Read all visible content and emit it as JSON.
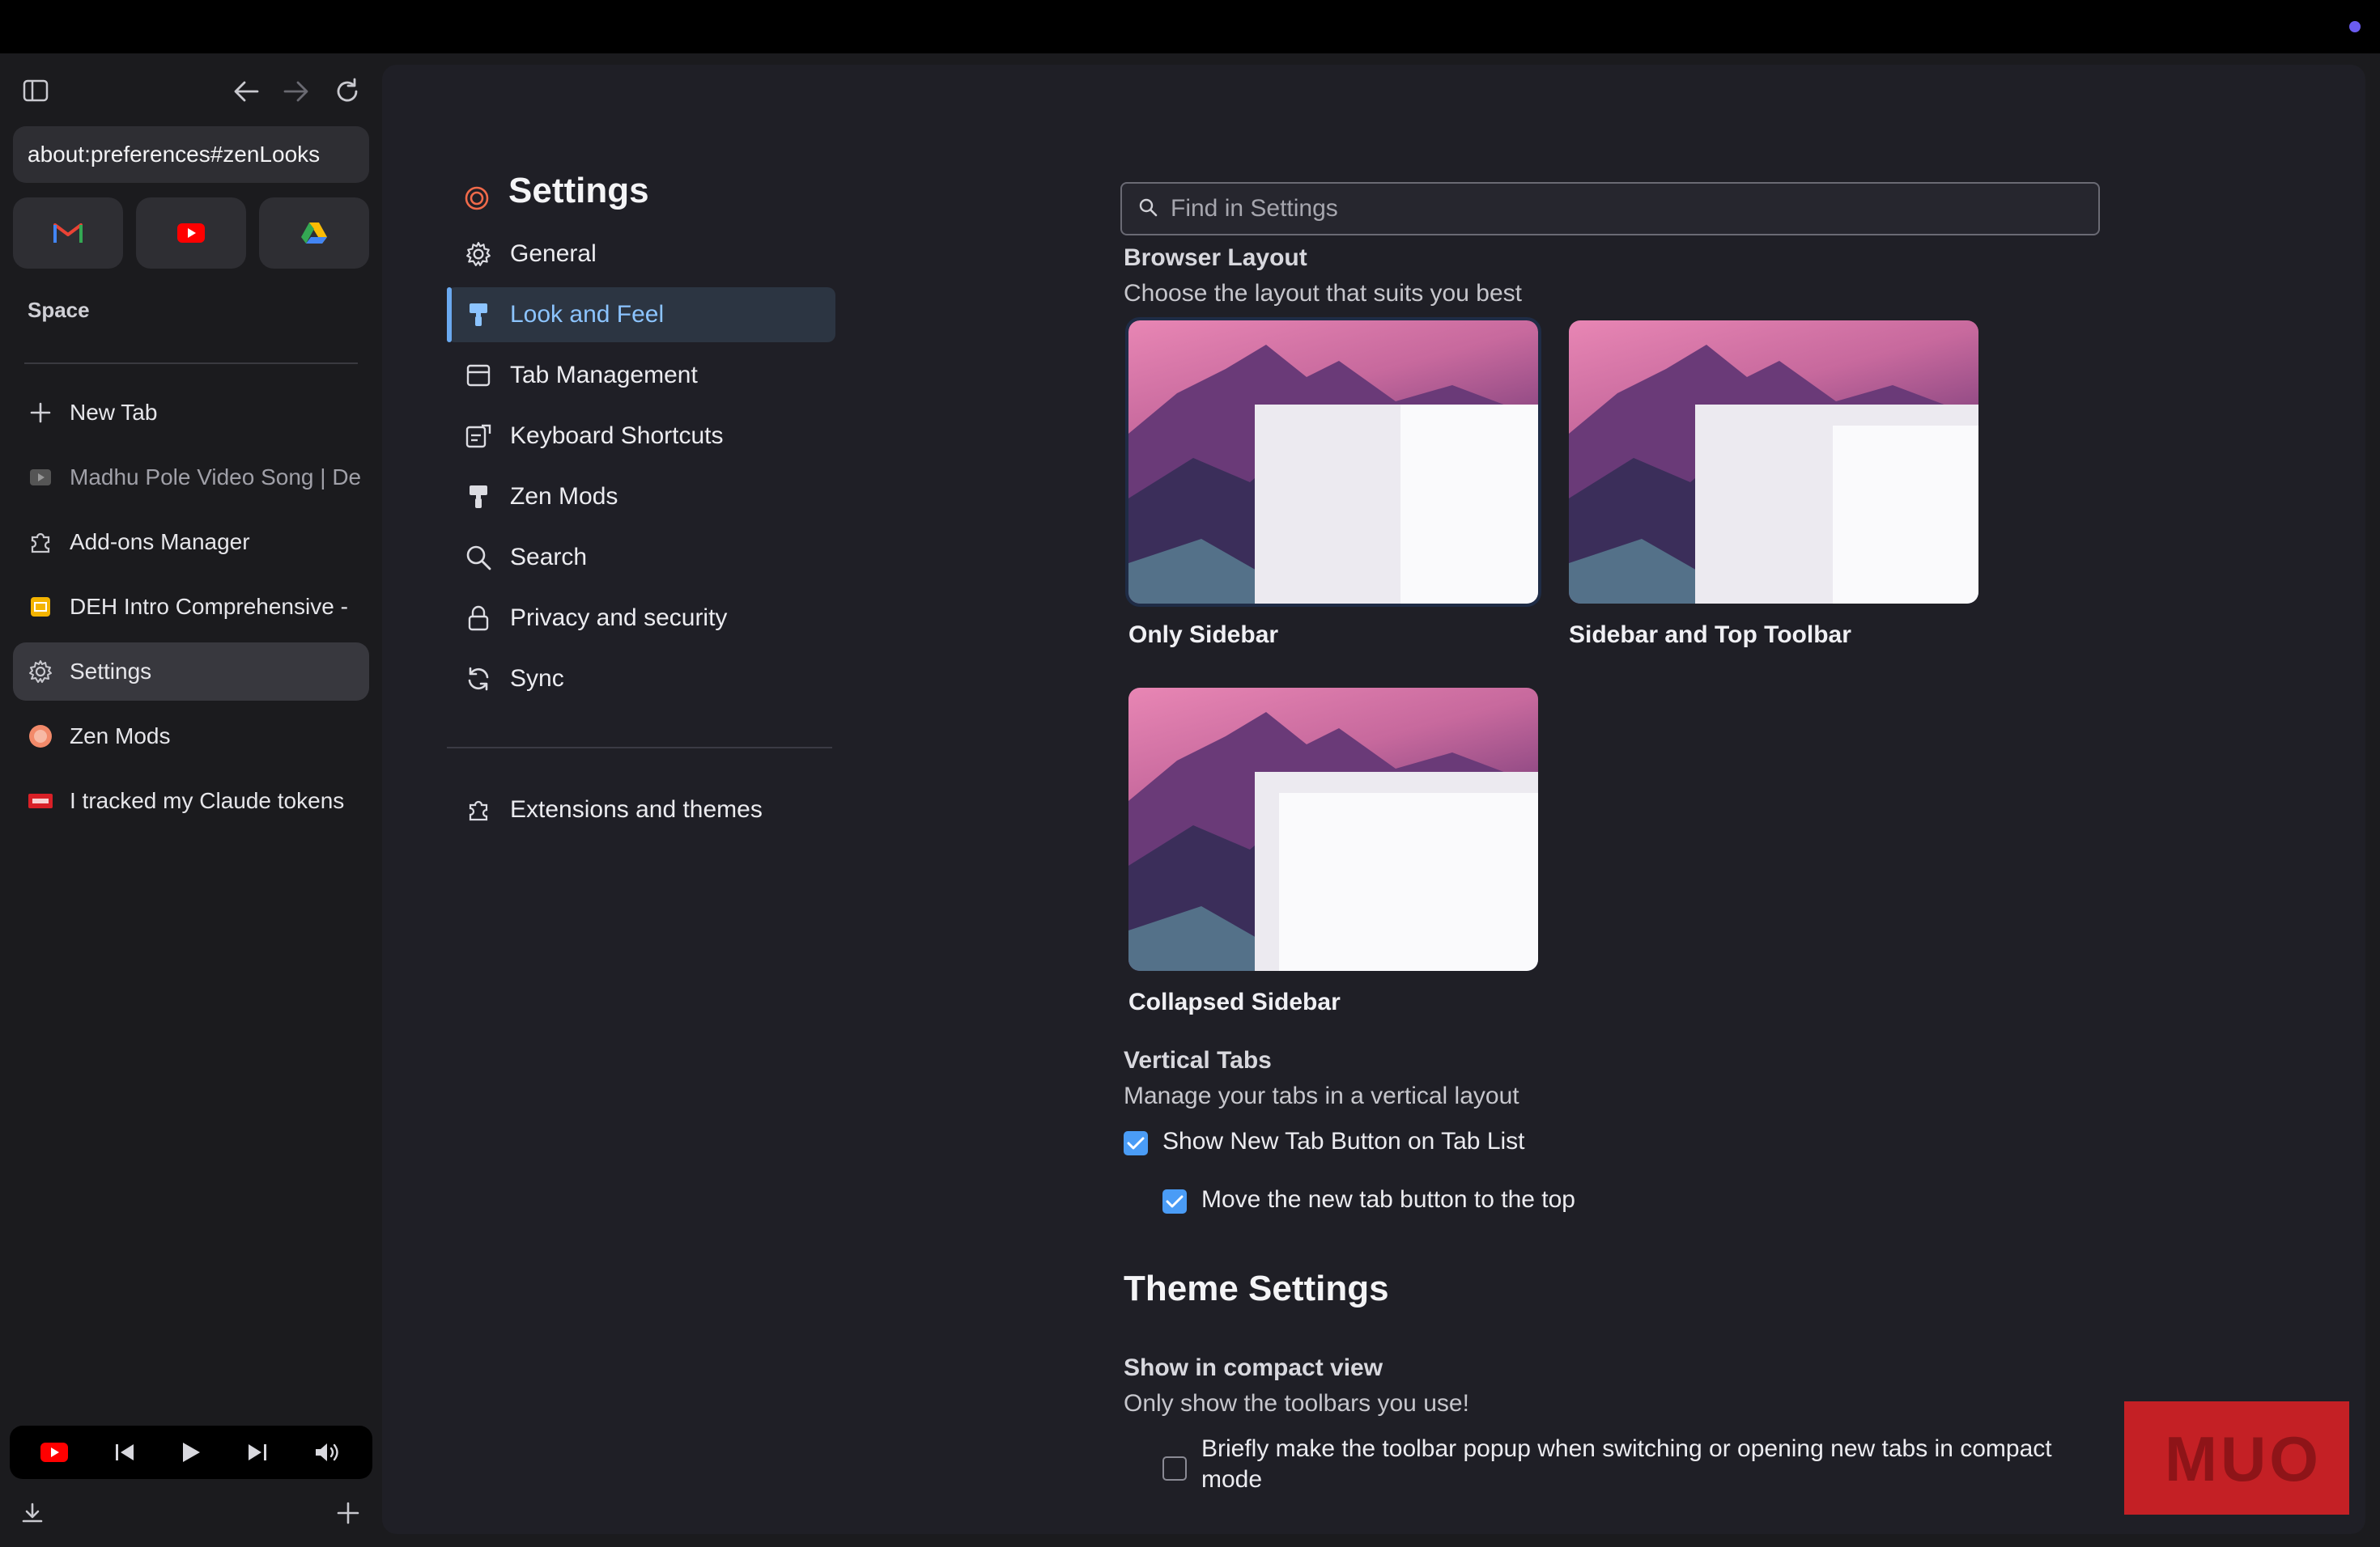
{
  "sidebar": {
    "url": "about:preferences#zenLooks",
    "space_label": "Space",
    "essentials": [
      {
        "name": "gmail",
        "color": "#ea4335"
      },
      {
        "name": "youtube",
        "color": "#ff0000"
      },
      {
        "name": "google-drive",
        "color": "#34a853"
      }
    ],
    "tabs": [
      {
        "label": "New Tab",
        "icon": "plus-icon"
      },
      {
        "label": "Madhu Pole Video Song | De",
        "icon": "video-icon"
      },
      {
        "label": "Add-ons Manager",
        "icon": "puzzle-icon"
      },
      {
        "label": "DEH Intro Comprehensive -",
        "icon": "slides-icon"
      },
      {
        "label": "Settings",
        "icon": "gear-icon"
      },
      {
        "label": "Zen Mods",
        "icon": "zen-icon"
      },
      {
        "label": "I tracked my Claude tokens",
        "icon": "muo-icon"
      }
    ]
  },
  "nav": {
    "title": "Settings",
    "items": [
      {
        "label": "General",
        "icon": "gear-icon"
      },
      {
        "label": "Look and Feel",
        "icon": "paint-roller-icon"
      },
      {
        "label": "Tab Management",
        "icon": "window-icon"
      },
      {
        "label": "Keyboard Shortcuts",
        "icon": "keyboard-icon"
      },
      {
        "label": "Zen Mods",
        "icon": "paint-roller-icon"
      },
      {
        "label": "Search",
        "icon": "search-icon"
      },
      {
        "label": "Privacy and security",
        "icon": "lock-icon"
      },
      {
        "label": "Sync",
        "icon": "sync-icon"
      }
    ],
    "extensions_label": "Extensions and themes"
  },
  "content": {
    "search_placeholder": "Find in Settings",
    "browser_layout": {
      "title": "Browser Layout",
      "description": "Choose the layout that suits you best",
      "options": [
        "Only Sidebar",
        "Sidebar and Top Toolbar",
        "Collapsed Sidebar"
      ]
    },
    "vertical_tabs": {
      "title": "Vertical Tabs",
      "description": "Manage your tabs in a vertical layout",
      "show_new_tab": "Show New Tab Button on Tab List",
      "move_new_tab": "Move the new tab button to the top"
    },
    "theme_settings": {
      "title": "Theme Settings",
      "compact_title": "Show in compact view",
      "compact_description": "Only show the toolbars you use!",
      "popup_option": "Briefly make the toolbar popup when switching or opening new tabs in compact mode"
    }
  },
  "watermark": "MUO"
}
